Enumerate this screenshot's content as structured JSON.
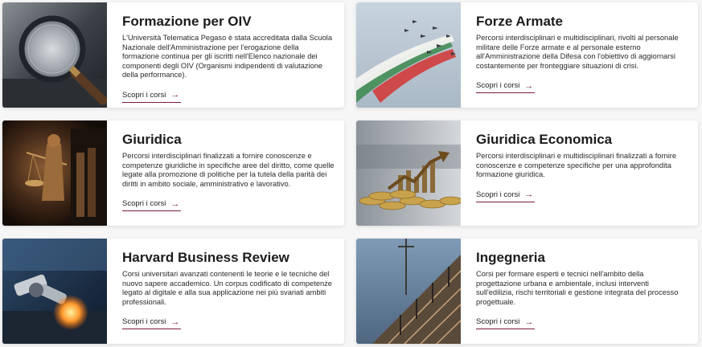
{
  "cards": [
    {
      "title": "Formazione per OIV",
      "description": "L'Università Telematica Pegaso è stata accreditata dalla Scuola Nazionale dell'Amministrazione per l'erogazione della formazione continua per gli iscritti nell'Elenco nazionale dei componenti degli OIV (Organismi indipendenti di valutazione della performance).",
      "link": "Scopri i corsi",
      "image": "magnifying-glass-image"
    },
    {
      "title": "Forze Armate",
      "description": "Percorsi interdisciplinari e multidisciplinari, rivolti al personale militare delle Forze armate e al personale esterno all'Amministrazione della Difesa con l'obiettivo di aggiornarsi costantemente per fronteggiare situazioni di crisi.",
      "link": "Scopri i corsi",
      "image": "frecce-tricolori-image"
    },
    {
      "title": "Giuridica",
      "description": "Percorsi interdisciplinari finalizzati a fornire conoscenze e competenze giuridiche in specifiche aree del diritto, come quelle legate alla promozione di politiche per la tutela della parità dei diritti in ambito sociale, amministrativo e lavorativo.",
      "link": "Scopri i corsi",
      "image": "justice-statue-image"
    },
    {
      "title": "Giuridica Economica",
      "description": "Percorsi interdisciplinari e multidisciplinari finalizzati a fornire conoscenze e competenze specifiche per una approfondita formazione giuridica.",
      "link": "Scopri i corsi",
      "image": "coins-growth-image"
    },
    {
      "title": "Harvard Business Review",
      "description": "Corsi universitari avanzati contenenti le teorie e le tecniche del nuovo sapere accademico. Un corpus codificato di competenze legato al digitale e alla sua applicazione nei più svariati ambiti professionali.",
      "link": "Scopri i corsi",
      "image": "robot-arm-image"
    },
    {
      "title": "Ingegneria",
      "description": "Corsi per formare esperti e tecnici nell'ambito della progettazione urbana e ambientale, inclusi interventi sull'edilizia, rischi territoriali e gestione integrata del processo progettuale.",
      "link": "Scopri i corsi",
      "image": "construction-scaffold-image"
    }
  ],
  "colors": {
    "accent": "#7a1f3d",
    "card_bg": "#ffffff",
    "page_bg": "#f6f6f6"
  }
}
